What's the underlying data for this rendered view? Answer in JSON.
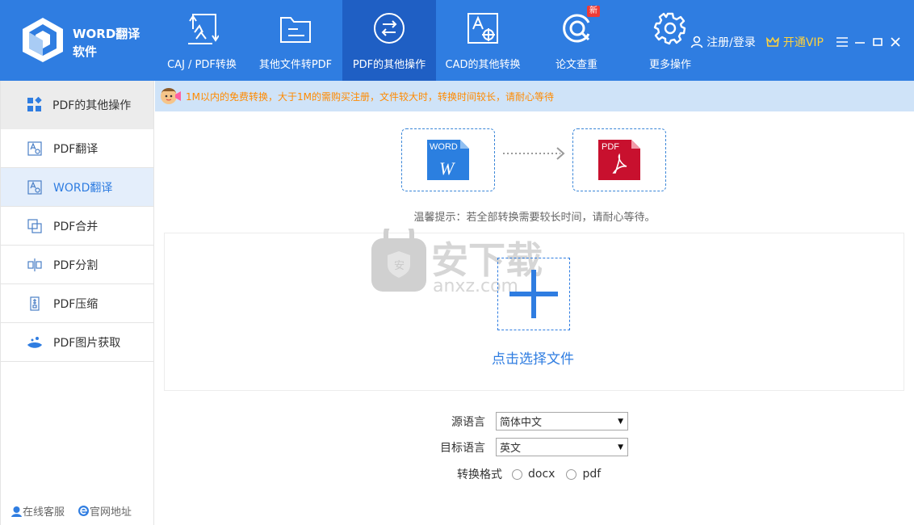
{
  "app": {
    "name_line1": "WORD翻译",
    "name_line2": "软件"
  },
  "nav": {
    "items": [
      {
        "label": "CAJ / PDF转换"
      },
      {
        "label": "其他文件转PDF"
      },
      {
        "label": "PDF的其他操作"
      },
      {
        "label": "CAD的其他转换"
      },
      {
        "label": "论文查重",
        "badge": "新"
      },
      {
        "label": "更多操作"
      }
    ],
    "active_index": 2
  },
  "header_right": {
    "login": "注册/登录",
    "vip": "开通VIP"
  },
  "sidebar": {
    "heading": "PDF的其他操作",
    "items": [
      {
        "label": "PDF翻译"
      },
      {
        "label": "WORD翻译"
      },
      {
        "label": "PDF合并"
      },
      {
        "label": "PDF分割"
      },
      {
        "label": "PDF压缩"
      },
      {
        "label": "PDF图片获取"
      }
    ],
    "active_index": 1,
    "bottom": {
      "service": "在线客服",
      "website": "官网地址"
    }
  },
  "notice": "1M以内的免费转换，大于1M的需购买注册，文件较大时，转换时间较长，请耐心等待",
  "conversion": {
    "from_label": "WORD",
    "to_label": "PDF"
  },
  "hint": "温馨提示：若全部转换需要较长时间，请耐心等待。",
  "watermark": {
    "text_cn": "安下载",
    "text_en": "anxz.com"
  },
  "upload": {
    "label": "点击选择文件"
  },
  "form": {
    "source_language_label": "源语言",
    "source_language_value": "简体中文",
    "target_language_label": "目标语言",
    "target_language_value": "英文",
    "format_label": "转换格式",
    "format_options": [
      "docx",
      "pdf"
    ]
  },
  "colors": {
    "primary": "#2f7de1",
    "active_nav": "#1f5fc4",
    "notice_bg": "#cfe3f8",
    "notice_text": "#ff8a00",
    "vip": "#ffd23c"
  }
}
